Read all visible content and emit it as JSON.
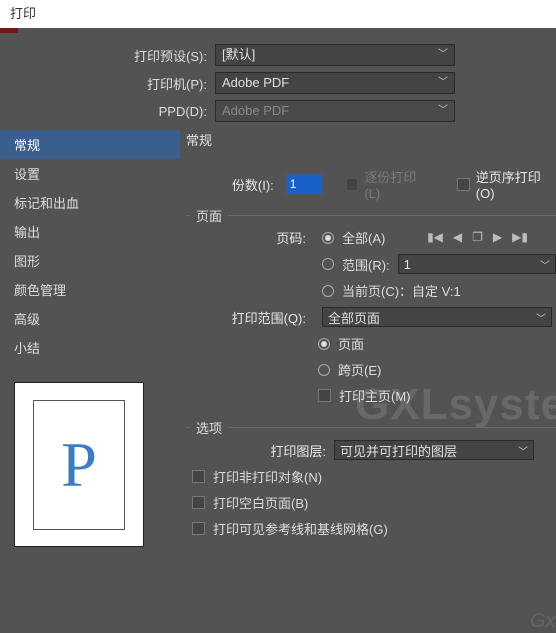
{
  "window": {
    "title": "打印"
  },
  "presets": {
    "label": "打印预设(S):",
    "value": "[默认]"
  },
  "printer": {
    "label": "打印机(P):",
    "value": "Adobe PDF"
  },
  "ppd": {
    "label": "PPD(D):",
    "value": "Adobe PDF"
  },
  "sidebar": {
    "items": [
      {
        "label": "常规",
        "selected": true
      },
      {
        "label": "设置"
      },
      {
        "label": "标记和出血"
      },
      {
        "label": "输出"
      },
      {
        "label": "图形"
      },
      {
        "label": "颜色管理"
      },
      {
        "label": "高级"
      },
      {
        "label": "小结"
      }
    ]
  },
  "preview": {
    "glyph": "P"
  },
  "general": {
    "title": "常规",
    "copies_label": "份数(I):",
    "copies_value": "1",
    "collate_label": "逐份打印(L)",
    "reverse_label": "逆页序打印(O)"
  },
  "pages": {
    "legend": "页面",
    "page_label": "页码:",
    "all_label": "全部(A)",
    "range_label": "范围(R):",
    "range_value": "1",
    "current_label": "当前页(C)：自定 V:1",
    "printrange_label": "打印范围(Q):",
    "printrange_value": "全部页面",
    "page_opt_label": "页面",
    "spread_label": "跨页(E)",
    "masters_label": "打印主页(M)"
  },
  "options": {
    "legend": "选项",
    "layer_label": "打印图层:",
    "layer_value": "可见并可打印的图层",
    "nonprint_label": "打印非打印对象(N)",
    "blank_label": "打印空白页面(B)",
    "guides_label": "打印可见参考线和基线网格(G)"
  },
  "watermark": {
    "t1": "GXLsystem",
    "t2": "Gxlsystem.com"
  }
}
